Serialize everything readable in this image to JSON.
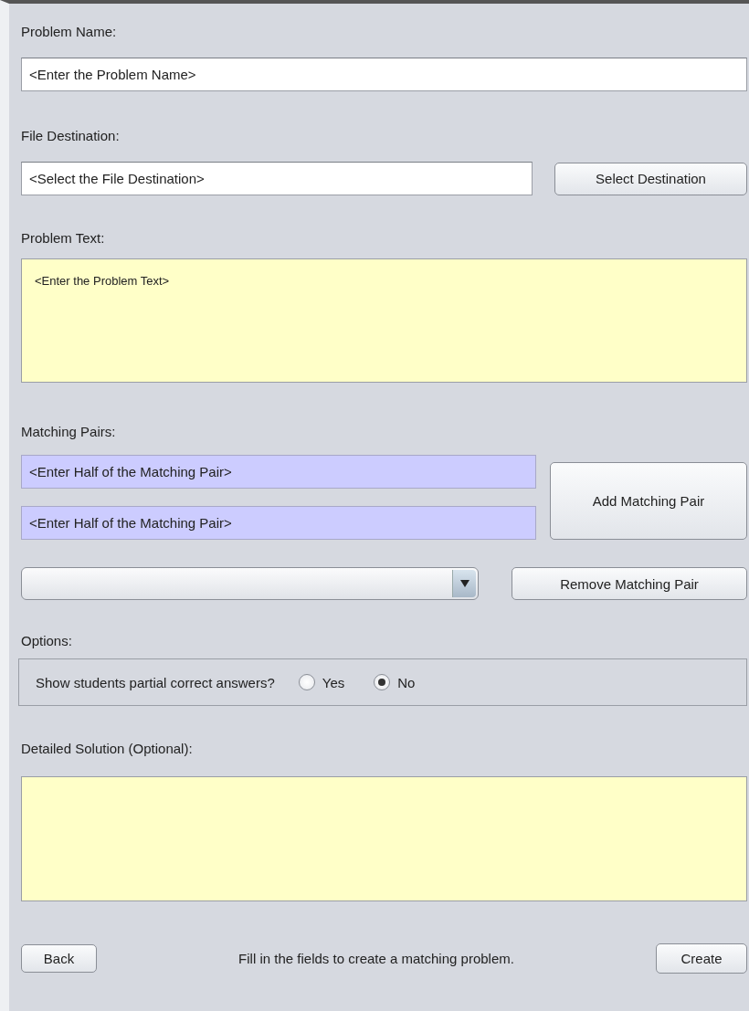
{
  "problem_name": {
    "label": "Problem Name:",
    "placeholder": "<Enter the Problem Name>"
  },
  "file_destination": {
    "label": "File Destination:",
    "placeholder": "<Select the File Destination>",
    "button": "Select Destination"
  },
  "problem_text": {
    "label": "Problem Text:",
    "placeholder": "<Enter the Problem Text>"
  },
  "matching_pairs": {
    "label": "Matching Pairs:",
    "fields": [
      {
        "placeholder": "<Enter Half of the Matching Pair>"
      },
      {
        "placeholder": "<Enter Half of the Matching Pair>"
      }
    ],
    "add_button": "Add Matching Pair",
    "remove_button": "Remove Matching Pair"
  },
  "options": {
    "label": "Options:",
    "question": "Show students partial correct answers?",
    "choices": [
      {
        "label": "Yes",
        "selected": false
      },
      {
        "label": "No",
        "selected": true
      }
    ]
  },
  "detailed_solution": {
    "label": "Detailed Solution (Optional):"
  },
  "footer": {
    "back_button": "Back",
    "status": "Fill in the fields to create a matching problem.",
    "create_button": "Create"
  }
}
